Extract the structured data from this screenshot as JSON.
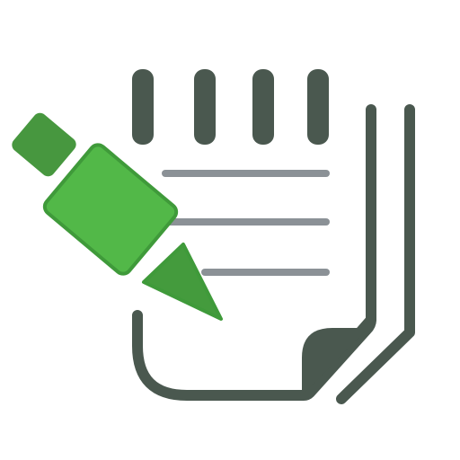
{
  "icon": {
    "name": "notepad-with-pencil-icon",
    "colors": {
      "background": "#ffffff",
      "notepad_stroke": "#4a584f",
      "notepad_binding": "#4a584f",
      "text_lines": "#8b9196",
      "curl_fill": "#4a584f",
      "pencil_body": "#52b848",
      "pencil_body_stroke": "#3f9a3a",
      "pencil_eraser": "#47973f",
      "pencil_tip": "#449b3d"
    },
    "parts": {
      "binding_rings": 4,
      "text_lines": 3,
      "back_pages": 2
    }
  }
}
